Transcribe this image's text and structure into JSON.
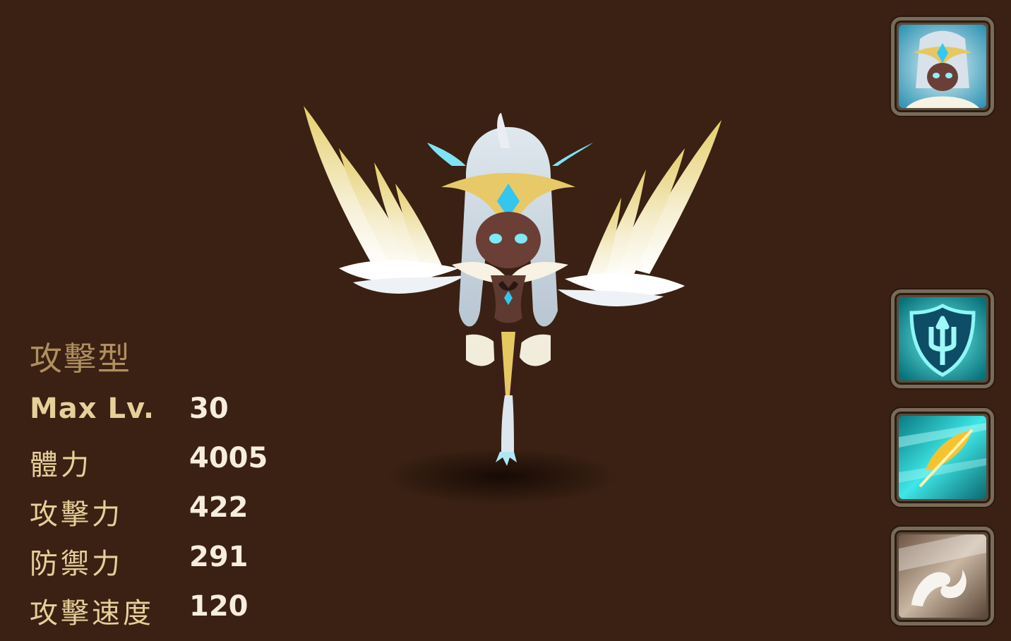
{
  "stats": {
    "type": "攻擊型",
    "rows": [
      {
        "label": "Max Lv.",
        "value": "30"
      },
      {
        "label": "體力",
        "value": "4005"
      },
      {
        "label": "攻擊力",
        "value": "422"
      },
      {
        "label": "防禦力",
        "value": "291"
      },
      {
        "label": "攻擊速度",
        "value": "120"
      }
    ]
  },
  "icons": {
    "portrait": "monster-portrait-icon",
    "skill1": "trident-shield-skill-icon",
    "skill2": "feather-skill-icon",
    "skill3": "claw-slash-skill-icon"
  },
  "colors": {
    "background": "#3a2113",
    "label": "#e7cf9a",
    "value": "#f7eddf",
    "type": "#b08f5f",
    "skill_teal": "#25c9c9"
  }
}
